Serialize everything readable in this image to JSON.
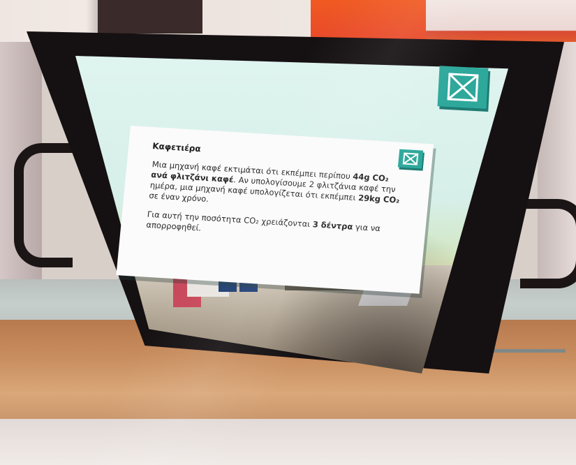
{
  "popup": {
    "title": "Καφετιέρα",
    "p1_a": "Μια μηχανή καφέ εκτιμάται ότι εκπέμπει περίπου ",
    "p1_b": "44g CO₂ ανά φλιτζάνι καφέ",
    "p1_c": ". Αν υπολογίσουμε 2 φλιτζάνια καφέ την ημέρα, μια μηχανή καφέ υπολογίζεται ότι εκπέμπει ",
    "p1_d": "29kg CO₂",
    "p1_e": " σε έναν χρόνο.",
    "p2_a": "Για αυτή την ποσότητα CO₂ χρειάζονται ",
    "p2_b": "3 δέντρα",
    "p2_c": " για να απορροφηθεί."
  },
  "icons": {
    "outer_close": "close-box-icon",
    "popup_close": "close-box-icon"
  },
  "colors": {
    "accent": "#2fa89c",
    "accent_shadow": "#1e7c73",
    "screen_bg": "#dff4ef",
    "wall_orange": "#f05a22",
    "wood": "#c88d5e"
  }
}
